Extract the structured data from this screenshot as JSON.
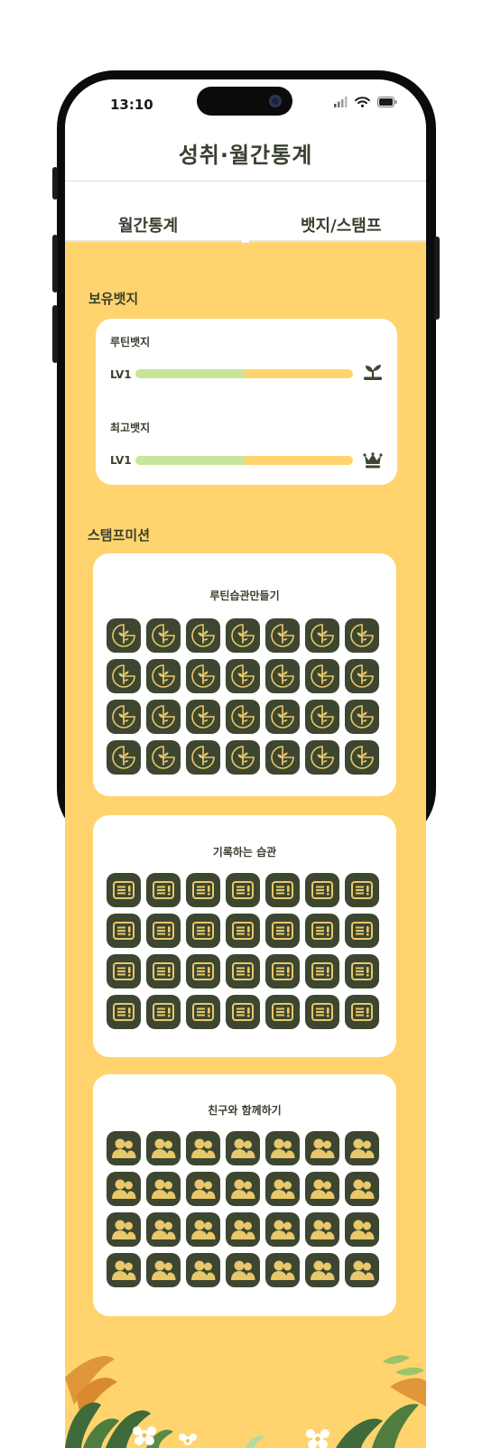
{
  "status_bar": {
    "time": "13:10"
  },
  "header": {
    "title": "성취·월간통계"
  },
  "tabs": [
    {
      "label": "월간통계"
    },
    {
      "label": "뱃지/스탬프"
    }
  ],
  "owned_badges": {
    "section_title": "보유뱃지",
    "items": [
      {
        "label": "루틴뱃지",
        "level": "LV1",
        "progress": 0.5,
        "icon": "sprout-icon"
      },
      {
        "label": "최고뱃지",
        "level": "LV1",
        "progress": 0.5,
        "icon": "crown-icon"
      }
    ]
  },
  "stamp_missions": {
    "section_title": "스탬프미션",
    "missions": [
      {
        "title": "루틴습관만들기",
        "stamp_icon": "sprout-clock-icon",
        "stamp_count": 28
      },
      {
        "title": "기록하는 습관",
        "stamp_icon": "note-exclaim-icon",
        "stamp_count": 28
      },
      {
        "title": "친구와 함께하기",
        "stamp_icon": "friends-icon",
        "stamp_count": 28
      }
    ]
  },
  "colors": {
    "background": "#ffd46e",
    "card": "#ffffff",
    "stamp_bg": "#3d4630",
    "stamp_accent": "#e8c86a",
    "progress_fill": "#c9e59a",
    "text_dark": "#3a4030"
  }
}
